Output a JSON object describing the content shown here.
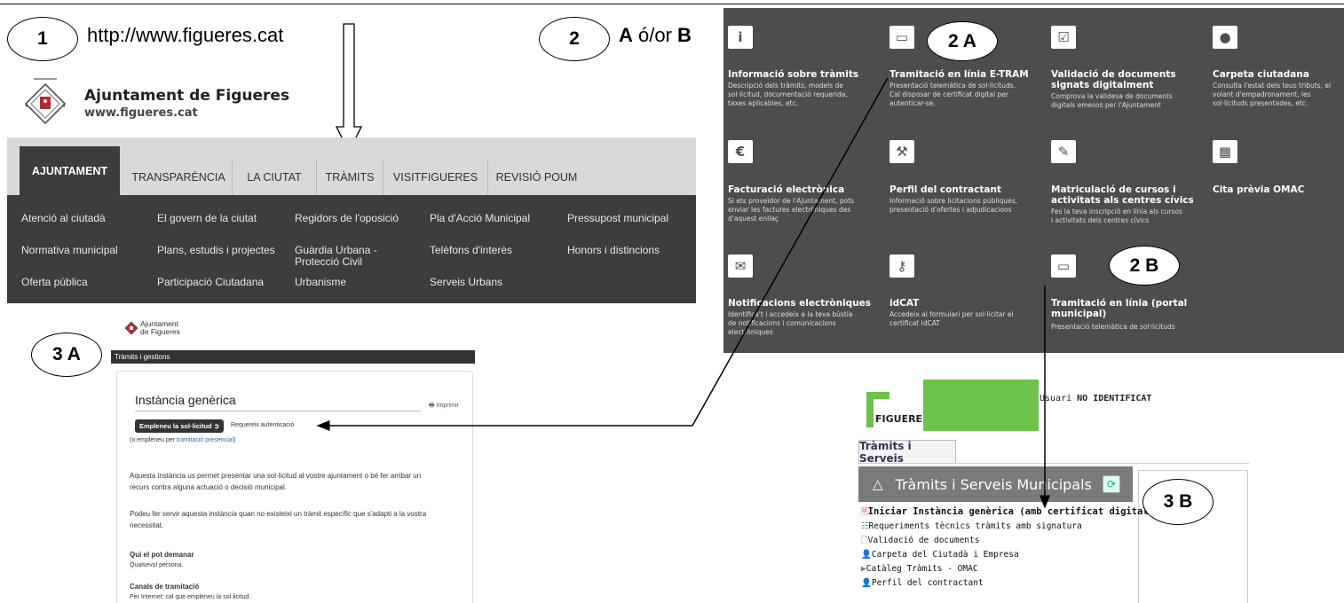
{
  "labels": {
    "c1": "1",
    "c2": "2",
    "c2a": "2 A",
    "c2b": "2 B",
    "c3a": "3 A",
    "c3b": "3 B"
  },
  "url": "http://www.figueres.cat",
  "ab_a": "A",
  "ab_mid": " ó/or ",
  "ab_b": "B",
  "site": {
    "title": "Ajuntament de Figueres",
    "subtitle": "www.figueres.cat",
    "tabs": [
      "AJUNTAMENT",
      "TRANSPARÈNCIA",
      "LA CIUTAT",
      "TRÀMITS",
      "VISITFIGUERES",
      "REVISIÓ POUM"
    ],
    "submenu": [
      [
        "Atenció al ciutadà",
        "El govern de la ciutat",
        "Regidors de l'oposició",
        "Pla d'Acció Municipal",
        "Pressupost municipal"
      ],
      [
        "Normativa municipal",
        "Plans, estudis i projectes",
        "Guàrdia Urbana -\nProtecció Civil",
        "Telèfons d'interès",
        "Honors i distincions"
      ],
      [
        "Oferta pública",
        "Participació Ciutadana",
        "Urbanisme",
        "Serveis Urbans",
        ""
      ]
    ]
  },
  "panel": [
    {
      "icon": "info-icon",
      "glyph": "i",
      "title": "Informació sobre tràmits",
      "desc": "Descripció dels tràmits, models de\nsol·licitud, documentació requerida,\ntaxes aplicables, etc."
    },
    {
      "icon": "monitor-icon",
      "glyph": "▭",
      "title": "Tramitació en línia E-TRAM",
      "desc": "Presentació telemàtica de sol·licituds.\nCal disposar de certificat digital per\nautenticar-se."
    },
    {
      "icon": "checkbox-icon",
      "glyph": "☑",
      "title": "Validació de documents\nsignats digitalment",
      "desc": "Comprova la validesa de documents\ndigitals emesos per l'Ajuntament"
    },
    {
      "icon": "user-icon",
      "glyph": "●",
      "title": "Carpeta ciutadana",
      "desc": "Consulta l'estat dels teus tributs, el\nvolant d'empadronament, les\nsol·licituds presentades, etc."
    },
    {
      "icon": "euro-icon",
      "glyph": "€",
      "title": "Facturació electrònica",
      "desc": "Si ets proveïdor de l'Ajuntament, pots\nenviar les factures electròniques des\nd'aquest enllaç"
    },
    {
      "icon": "gavel-icon",
      "glyph": "⚒",
      "title": "Perfil del contractant",
      "desc": "Informació sobre licitacions públiques,\npresentació d'ofertes i adjudicacions"
    },
    {
      "icon": "edit-icon",
      "glyph": "✎",
      "title": "Matriculació de cursos i\nactivitats als centres cívics",
      "desc": "Fes la teva inscripció en línia als cursos\ni activitats dels centres cívics"
    },
    {
      "icon": "calendar-icon",
      "glyph": "▦",
      "title": "Cita prèvia OMAC",
      "desc": ""
    },
    {
      "icon": "envelope-icon",
      "glyph": "✉",
      "title": "Notificacions electròniques",
      "desc": "Identifica't i accedeix a la teva bústia\nde notificacions i comunicacions\nelectròniques"
    },
    {
      "icon": "key-icon",
      "glyph": "⚷",
      "title": "idCAT",
      "desc": "Accedeix al formulari per sol·licitar el\ncertificat idCAT"
    },
    {
      "icon": "monitor-icon",
      "glyph": "▭",
      "title": "Tramitació en línia (portal\nmunicipal)",
      "desc": "Presentació telemàtica de sol·licituds"
    }
  ],
  "s3a": {
    "logo_line1": "Ajuntament",
    "logo_line2": "de Figueres",
    "bar": "Tràmits i gestions",
    "title": "Instància genèrica",
    "print": "Imprimir",
    "button": "Empleneu la sol·licitud",
    "auth": "Requereix autenticació",
    "alt_prefix": "(o empleneu per ",
    "alt_link": "tramitació presencial",
    "alt_suffix": ")",
    "p1": "Aquesta instància us permet presentar una sol·licitud al vostre ajuntament o bé fer arribar un\nrecurs contra alguna actuació o decisió municipal.",
    "p2": "Podeu fer servir aquesta instància quan no existeixi un tràmit específic que s'adapti a la vostra\nnecessitat.",
    "h1": "Qui el pot demanar",
    "t1": "Qualsevol persona.",
    "h2": "Canals de tramitació",
    "t2": "Per Internet: cal que empleneu la sol·licitud."
  },
  "s3b": {
    "logo": "FIGUERES",
    "user_label": "Usuari ",
    "user_value": "NO IDENTIFICAT",
    "tab": "Tràmits i Serveis",
    "heading": "Tràmits i Serveis Municipals",
    "items": [
      "Iniciar Instància genèrica (amb certificat digital)",
      "Requeriments tècnics tràmits amb signatura",
      "Validació de documents",
      "Carpeta del Ciutadà i Empresa",
      "Catàleg Tràmits - OMAC",
      "Perfil del contractant"
    ]
  }
}
